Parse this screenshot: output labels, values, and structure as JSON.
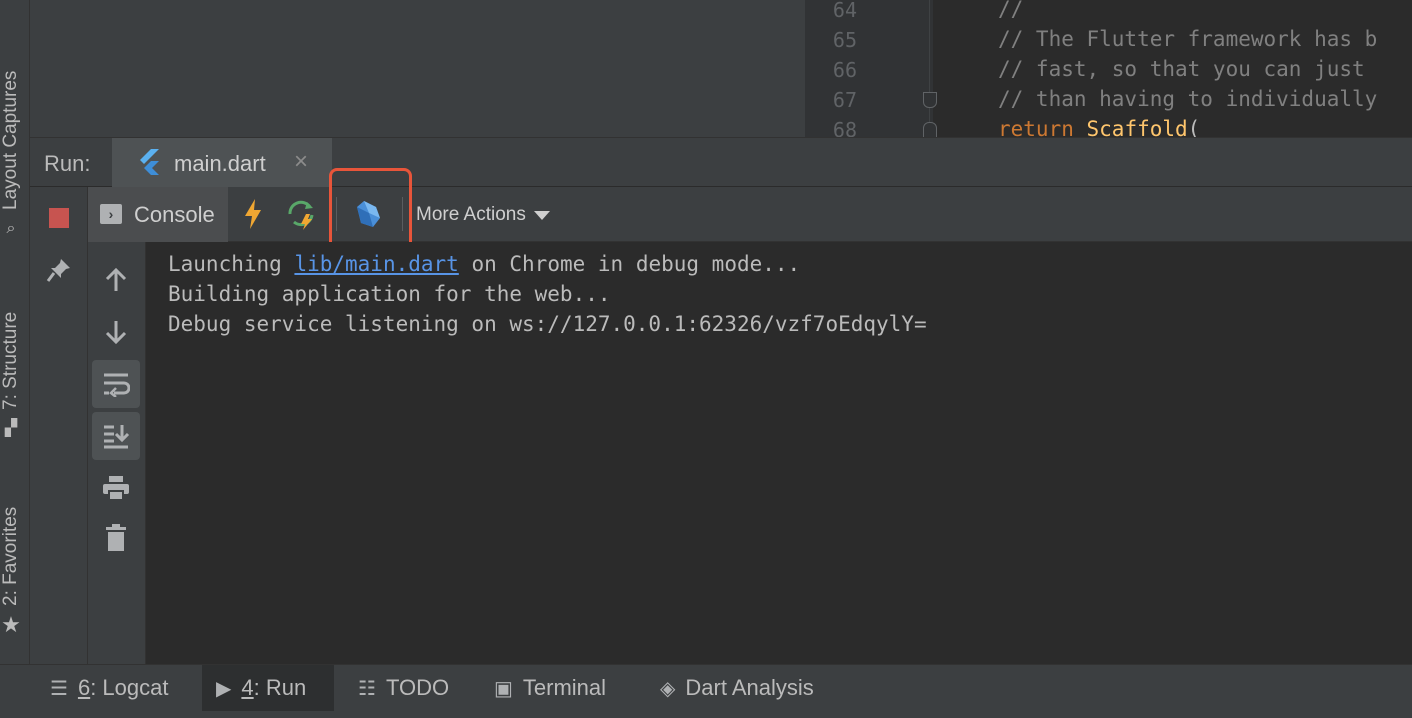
{
  "left_strip": {
    "tabs": [
      {
        "label": "Layout Captures",
        "icon": "layout-captures-icon"
      },
      {
        "label": "7: Structure",
        "icon": "structure-icon"
      },
      {
        "label": "2: Favorites",
        "icon": "star-icon"
      }
    ]
  },
  "editor": {
    "lines": [
      {
        "num": "64",
        "text": "//"
      },
      {
        "num": "65",
        "text": "// The Flutter framework has b"
      },
      {
        "num": "66",
        "text": "// fast, so that you can just"
      },
      {
        "num": "67",
        "text": "// than having to individually"
      },
      {
        "num": "68",
        "kw": "return",
        "cls": "Scaffold",
        "rest": "("
      }
    ]
  },
  "run_window": {
    "label": "Run:",
    "tab": {
      "label": "main.dart",
      "icon": "flutter-icon",
      "close": "×"
    },
    "toolbar": {
      "console_label": "Console",
      "more_actions_label": "More Actions",
      "buttons": [
        "hot-reload-icon",
        "hot-restart-icon",
        "dart-devtools-icon"
      ]
    },
    "side_buttons": [
      "stop-icon",
      "pin-icon"
    ],
    "console_buttons": [
      "scroll-up-icon",
      "scroll-down-icon",
      "soft-wrap-icon",
      "scroll-to-end-icon",
      "print-icon",
      "clear-icon"
    ],
    "output": {
      "line1_prefix": "Launching ",
      "line1_link": "lib/main.dart",
      "line1_suffix": " on Chrome in debug mode...",
      "line2": "Building application for the web...",
      "line3": "Debug service listening on ws://127.0.0.1:62326/vzf7oEdqylY="
    }
  },
  "bottom_bar": {
    "tabs": [
      {
        "num": "6",
        "label": ": Logcat",
        "icon": "logcat-icon"
      },
      {
        "num": "4",
        "label": ": Run",
        "icon": "run-icon",
        "active": true
      },
      {
        "label": "TODO",
        "icon": "todo-icon"
      },
      {
        "label": "Terminal",
        "icon": "terminal-icon"
      },
      {
        "label": "Dart Analysis",
        "icon": "dart-analysis-icon"
      }
    ]
  },
  "colors": {
    "highlight": "#e8553a",
    "link": "#5894e6",
    "stop": "#c75450",
    "hot_reload": "#f0a732",
    "hot_restart": "#59a869"
  }
}
